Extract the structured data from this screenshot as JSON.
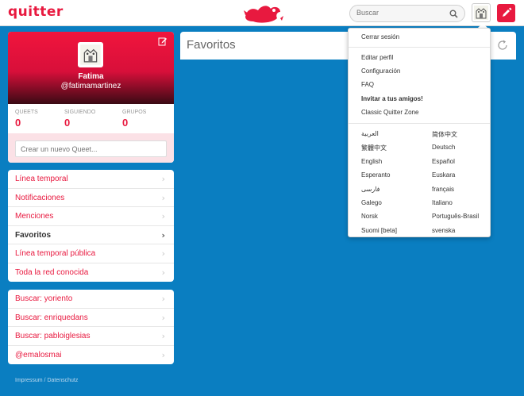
{
  "header": {
    "logo": "quitter",
    "search_placeholder": "Buscar"
  },
  "profile": {
    "name": "Fatima",
    "handle": "@fatimamartinez",
    "stats": [
      {
        "label": "QUEETS",
        "value": "0"
      },
      {
        "label": "SIGUIENDO",
        "value": "0"
      },
      {
        "label": "GRUPOS",
        "value": "0"
      }
    ],
    "compose_placeholder": "Crear un nuevo Queet..."
  },
  "nav": [
    {
      "label": "Línea temporal"
    },
    {
      "label": "Notificaciones"
    },
    {
      "label": "Menciones"
    },
    {
      "label": "Favoritos"
    },
    {
      "label": "Línea temporal pública"
    },
    {
      "label": "Toda la red conocida"
    }
  ],
  "saved_searches": [
    {
      "label": "Buscar: yoriento"
    },
    {
      "label": "Buscar: enriquedans"
    },
    {
      "label": "Buscar: pabloiglesias"
    },
    {
      "label": "@emalosmai"
    }
  ],
  "footer": "Impressum / Datenschutz",
  "feed": {
    "title": "Favoritos"
  },
  "dropdown": {
    "logout": "Cerrar sesión",
    "edit_profile": "Editar perfil",
    "settings": "Configuración",
    "faq": "FAQ",
    "invite": "Invitar a tus amigos!",
    "classic": "Classic Quitter Zone",
    "languages": [
      "العربية",
      "简体中文",
      "繁體中文",
      "Deutsch",
      "English",
      "Español",
      "Esperanto",
      "Euskara",
      "فارسی",
      "français",
      "Galego",
      "Italiano",
      "Norsk",
      "Português-Brasil",
      "Suomi [beta]",
      "svenska"
    ]
  },
  "colors": {
    "accent": "#e8193f",
    "background": "#0a7ec1"
  },
  "icons": [
    "bird-logo-icon",
    "search-icon",
    "avatar",
    "compose-icon",
    "edit-icon",
    "chevron-right-icon",
    "reload-icon"
  ]
}
